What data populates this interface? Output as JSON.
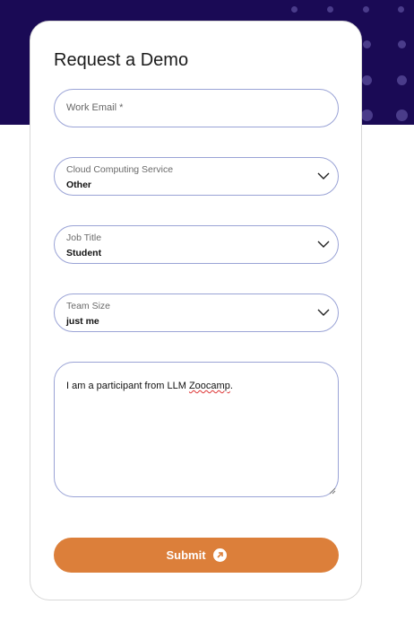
{
  "form": {
    "title": "Request a Demo",
    "work_email": {
      "placeholder": "Work Email *"
    },
    "cloud_service": {
      "label": "Cloud Computing Service",
      "value": "Other"
    },
    "job_title": {
      "label": "Job Title",
      "value": "Student"
    },
    "team_size": {
      "label": "Team Size",
      "value": "just me"
    },
    "message": {
      "prefix": "I am a participant from LLM ",
      "misspelled": "Zoocamp",
      "suffix": "."
    },
    "submit_label": "Submit"
  },
  "colors": {
    "hero_background": "#1a0a55",
    "accent": "#dc7f3a",
    "field_border": "#9aa3d6"
  },
  "icons": [
    "chevron-down-icon",
    "arrow-up-right-icon"
  ]
}
